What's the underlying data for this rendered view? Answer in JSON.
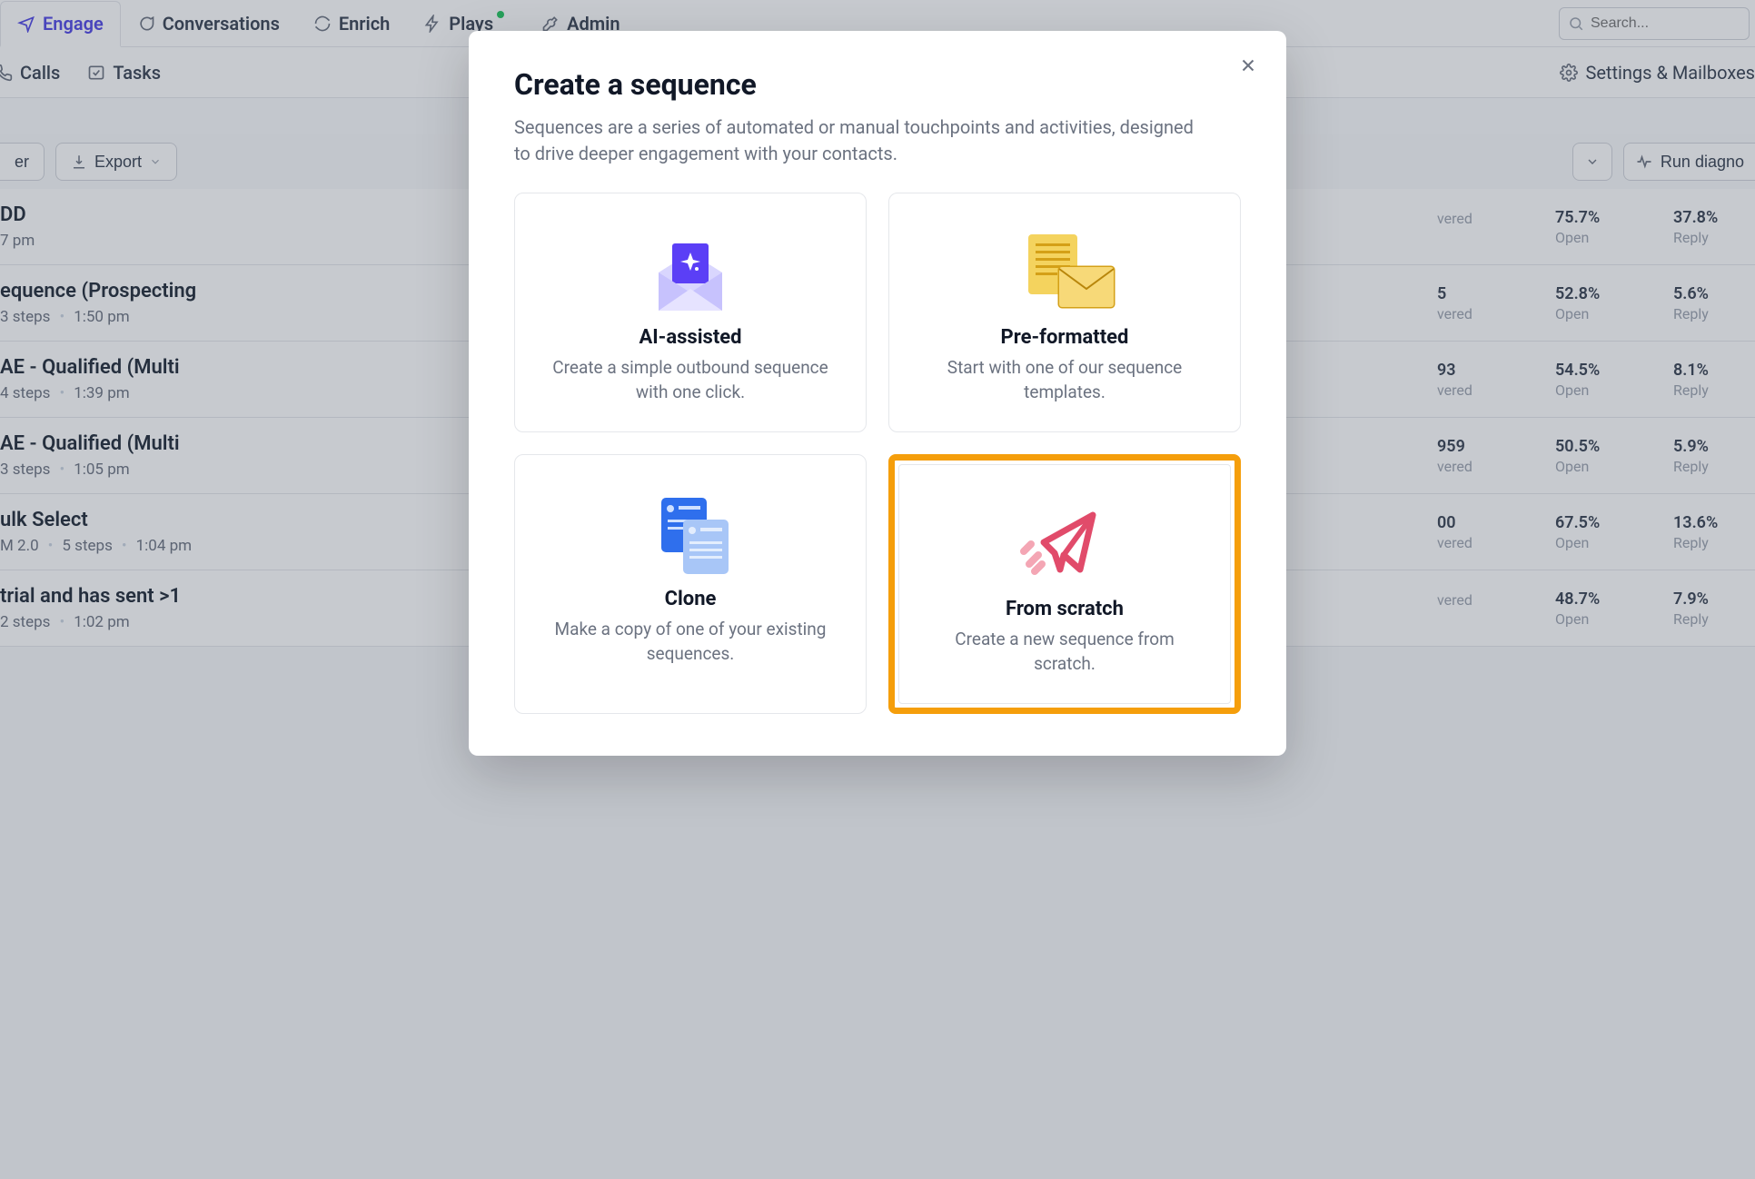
{
  "nav": {
    "engage": "Engage",
    "conversations": "Conversations",
    "enrich": "Enrich",
    "plays": "Plays",
    "admin": "Admin"
  },
  "search": {
    "placeholder": "Search..."
  },
  "subnav": {
    "calls": "Calls",
    "tasks": "Tasks",
    "settings": "Settings & Mailboxes"
  },
  "toolbar": {
    "filter": "er",
    "export": "Export",
    "run": "Run diagno"
  },
  "columns": {
    "delivered": "vered",
    "open": "Open",
    "reply": "Reply"
  },
  "sequences": [
    {
      "title": "DD",
      "meta_prefix": "",
      "steps": "",
      "time": "7 pm",
      "delivered_val": "",
      "open": "75.7%",
      "reply": "37.8%"
    },
    {
      "title": "equence (Prospecting",
      "meta_prefix": "",
      "steps": "3 steps",
      "time": "1:50 pm",
      "delivered_val": "5",
      "open": "52.8%",
      "reply": "5.6%"
    },
    {
      "title": "AE - Qualified (Multi",
      "meta_prefix": "",
      "steps": "4 steps",
      "time": "1:39 pm",
      "delivered_val": "93",
      "open": "54.5%",
      "reply": "8.1%"
    },
    {
      "title": "AE - Qualified (Multi",
      "meta_prefix": "",
      "steps": "3 steps",
      "time": "1:05 pm",
      "delivered_val": "959",
      "open": "50.5%",
      "reply": "5.9%"
    },
    {
      "title": "ulk Select",
      "meta_prefix": "M 2.0",
      "steps": "5 steps",
      "time": "1:04 pm",
      "delivered_val": "00",
      "open": "67.5%",
      "reply": "13.6%"
    },
    {
      "title": "trial and has sent >1",
      "meta_prefix": "",
      "steps": "2 steps",
      "time": "1:02 pm",
      "delivered_val": "",
      "open": "48.7%",
      "reply": "7.9%"
    }
  ],
  "modal": {
    "title": "Create a sequence",
    "subtitle": "Sequences are a series of automated or manual touchpoints and activities, designed to drive deeper engagement with your contacts.",
    "cards": {
      "ai": {
        "title": "AI-assisted",
        "desc": "Create a simple outbound sequence with one click."
      },
      "pre": {
        "title": "Pre-formatted",
        "desc": "Start with one of our sequence templates."
      },
      "clone": {
        "title": "Clone",
        "desc": "Make a copy of one of your existing sequences."
      },
      "scratch": {
        "title": "From scratch",
        "desc": "Create a new sequence from scratch."
      }
    }
  }
}
